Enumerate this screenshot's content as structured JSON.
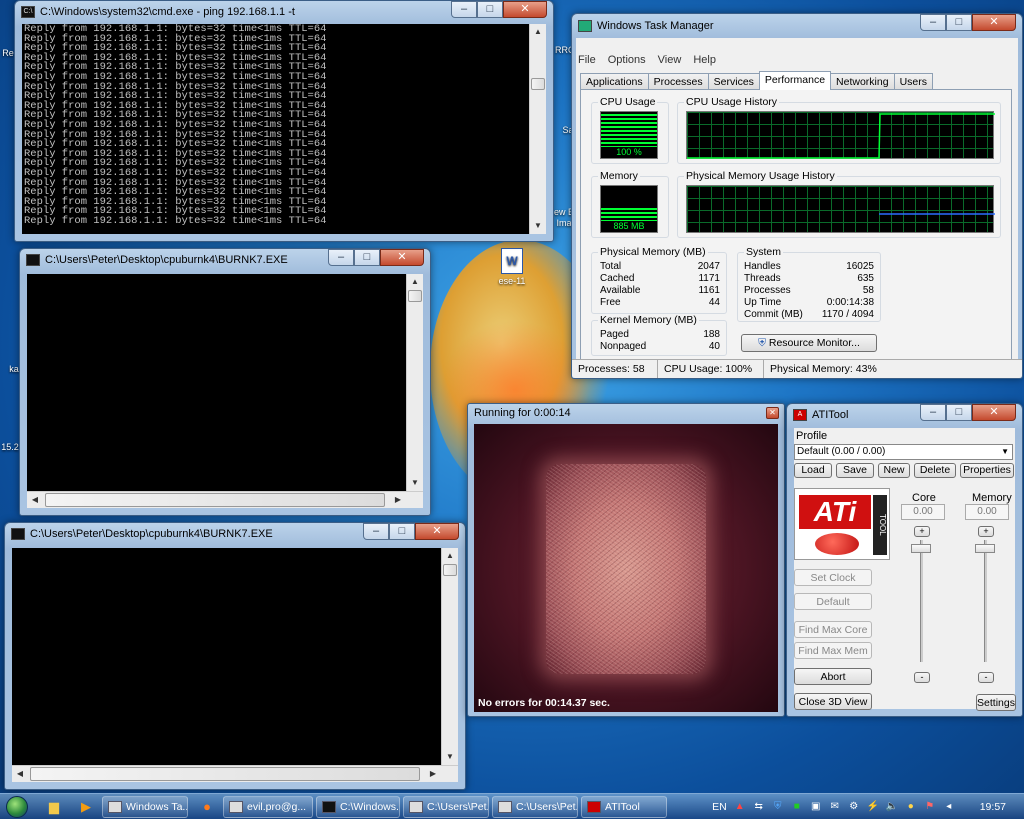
{
  "cmd_window": {
    "title": "C:\\Windows\\system32\\cmd.exe - ping  192.168.1.1 -t",
    "lines": [
      "Reply from 192.168.1.1: bytes=32 time<1ms TTL=64",
      "Reply from 192.168.1.1: bytes=32 time<1ms TTL=64",
      "Reply from 192.168.1.1: bytes=32 time<1ms TTL=64",
      "Reply from 192.168.1.1: bytes=32 time<1ms TTL=64",
      "Reply from 192.168.1.1: bytes=32 time<1ms TTL=64",
      "Reply from 192.168.1.1: bytes=32 time<1ms TTL=64",
      "Reply from 192.168.1.1: bytes=32 time<1ms TTL=64",
      "Reply from 192.168.1.1: bytes=32 time<1ms TTL=64",
      "Reply from 192.168.1.1: bytes=32 time<1ms TTL=64",
      "Reply from 192.168.1.1: bytes=32 time<1ms TTL=64",
      "Reply from 192.168.1.1: bytes=32 time<1ms TTL=64",
      "Reply from 192.168.1.1: bytes=32 time<1ms TTL=64",
      "Reply from 192.168.1.1: bytes=32 time<1ms TTL=64",
      "Reply from 192.168.1.1: bytes=32 time<1ms TTL=64",
      "Reply from 192.168.1.1: bytes=32 time<1ms TTL=64",
      "Reply from 192.168.1.1: bytes=32 time<1ms TTL=64",
      "Reply from 192.168.1.1: bytes=32 time<1ms TTL=64",
      "Reply from 192.168.1.1: bytes=32 time<1ms TTL=64",
      "Reply from 192.168.1.1: bytes=32 time<1ms TTL=64",
      "Reply from 192.168.1.1: bytes=32 time<1ms TTL=64",
      "Reply from 192.168.1.1: bytes=32 time<1ms TTL=64"
    ]
  },
  "burn_window_1": {
    "title": "C:\\Users\\Peter\\Desktop\\cpuburnk4\\BURNK7.EXE"
  },
  "burn_window_2": {
    "title": "C:\\Users\\Peter\\Desktop\\cpuburnk4\\BURNK7.EXE"
  },
  "task_manager": {
    "title": "Windows Task Manager",
    "menu": [
      "File",
      "Options",
      "View",
      "Help"
    ],
    "tabs": [
      "Applications",
      "Processes",
      "Services",
      "Performance",
      "Networking",
      "Users"
    ],
    "active_tab": "Performance",
    "cpu_usage_label": "CPU Usage",
    "cpu_usage_value": "100 %",
    "cpu_history_label": "CPU Usage History",
    "memory_label": "Memory",
    "memory_value": "885 MB",
    "memory_history_label": "Physical Memory Usage History",
    "physical_memory": {
      "label": "Physical Memory (MB)",
      "rows": [
        [
          "Total",
          "2047"
        ],
        [
          "Cached",
          "1171"
        ],
        [
          "Available",
          "1161"
        ],
        [
          "Free",
          "44"
        ]
      ]
    },
    "kernel_memory": {
      "label": "Kernel Memory (MB)",
      "rows": [
        [
          "Paged",
          "188"
        ],
        [
          "Nonpaged",
          "40"
        ]
      ]
    },
    "system": {
      "label": "System",
      "rows": [
        [
          "Handles",
          "16025"
        ],
        [
          "Threads",
          "635"
        ],
        [
          "Processes",
          "58"
        ],
        [
          "Up Time",
          "0:00:14:38"
        ],
        [
          "Commit (MB)",
          "1170 / 4094"
        ]
      ]
    },
    "resource_monitor_label": "Resource Monitor...",
    "status": {
      "processes": "Processes: 58",
      "cpu": "CPU Usage: 100%",
      "memory": "Physical Memory: 43%"
    }
  },
  "render_window": {
    "title": "Running for 0:00:14",
    "overlay": "No errors for 00:14.37 sec."
  },
  "atitool": {
    "title": "ATITool",
    "profile_label": "Profile",
    "profile_value": "Default (0.00 / 0.00)",
    "buttons": {
      "load": "Load",
      "save": "Save",
      "new": "New",
      "delete": "Delete",
      "properties": "Properties"
    },
    "logo_text": "ATi",
    "logo_subtext": "TOOL",
    "core_label": "Core",
    "memory_label": "Memory",
    "core_value": "0.00",
    "memory_value": "0.00",
    "plus": "+",
    "minus": "-",
    "set_clock": "Set Clock",
    "default": "Default",
    "find_max_core": "Find Max Core",
    "find_max_mem": "Find Max Mem",
    "abort": "Abort",
    "close_3d": "Close 3D View",
    "settings": "Settings"
  },
  "desktop_icons": {
    "ese11": "ese-11",
    "left1": "15.2",
    "left2": "ka",
    "top_r": "RRO",
    "right_s": "Sa",
    "right_ew": "ew B",
    "right_ima": "Ima",
    "top_re": "Re"
  },
  "taskbar": {
    "items": [
      "Windows Ta...",
      "evil.pro@g...",
      "C:\\Windows...",
      "C:\\Users\\Pet...",
      "C:\\Users\\Pet...",
      "ATITool"
    ],
    "lang": "EN",
    "clock": "19:57"
  },
  "colors": {
    "graph_green": "#00ff33",
    "memory_line": "#2a6cff",
    "close_red": "#c44a2e"
  }
}
